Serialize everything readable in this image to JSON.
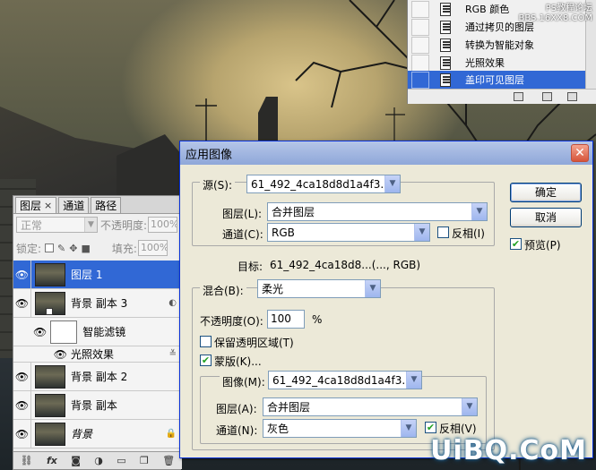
{
  "top_layers": {
    "items": [
      {
        "label": "RGB 颜色"
      },
      {
        "label": "通过拷贝的图层"
      },
      {
        "label": "转换为智能对象"
      },
      {
        "label": "光照效果"
      },
      {
        "label": "盖印可见图层",
        "selected": true
      }
    ],
    "watermark": "PS教程论坛\nBBS.16XX8.COM"
  },
  "layers_panel": {
    "tabs": [
      {
        "label": "图层",
        "close": "×"
      },
      {
        "label": "通道"
      },
      {
        "label": "路径"
      }
    ],
    "blend_mode": "正常",
    "opacity_label": "不透明度:",
    "opacity_value": "100%",
    "lock_label": "锁定:",
    "fill_label": "填充:",
    "fill_value": "100%",
    "layers": [
      {
        "name": "图层 1",
        "selected": true
      },
      {
        "name": "背景 副本 3"
      },
      {
        "name": "智能滤镜"
      },
      {
        "name": "光照效果"
      },
      {
        "name": "背景 副本 2"
      },
      {
        "name": "背景 副本"
      },
      {
        "name": "背景"
      }
    ],
    "bottom_icons": [
      "link-icon",
      "fx-icon",
      "mask-icon",
      "adjustment-icon",
      "folder-icon",
      "new-layer-icon",
      "trash-icon"
    ]
  },
  "dialog": {
    "title": "应用图像",
    "close_glyph": "✕",
    "source": {
      "legend": "源(S):",
      "source_value": "61_492_4ca18d8d1a4f3...",
      "layer_label": "图层(L):",
      "layer_value": "合并图层",
      "channel_label": "通道(C):",
      "channel_value": "RGB",
      "invert_label": "反相(I)",
      "invert_checked": false
    },
    "target_label": "目标:",
    "target_value": "61_492_4ca18d8...(..., RGB)",
    "blending": {
      "legend": "混合(B):",
      "blend_value": "柔光",
      "opacity_label": "不透明度(O):",
      "opacity_value": "100",
      "opacity_unit": "%",
      "preserve_label": "保留透明区域(T)",
      "preserve_checked": false,
      "mask_label": "蒙版(K)...",
      "mask_checked": true
    },
    "mask": {
      "image_label": "图像(M):",
      "image_value": "61_492_4ca18d8d1a4f3...",
      "layer_label": "图层(A):",
      "layer_value": "合并图层",
      "channel_label": "通道(N):",
      "channel_value": "灰色",
      "invert_label": "反相(V)",
      "invert_checked": true
    },
    "ok_label": "确定",
    "cancel_label": "取消",
    "preview_label": "预览(P)",
    "preview_checked": true
  },
  "brand": "UiBQ.CoM",
  "colors": {
    "selection": "#3168d5",
    "dialog_bg": "#ece9d8",
    "title_bar": "#8fa7d9",
    "close_button": "#d6543a"
  }
}
